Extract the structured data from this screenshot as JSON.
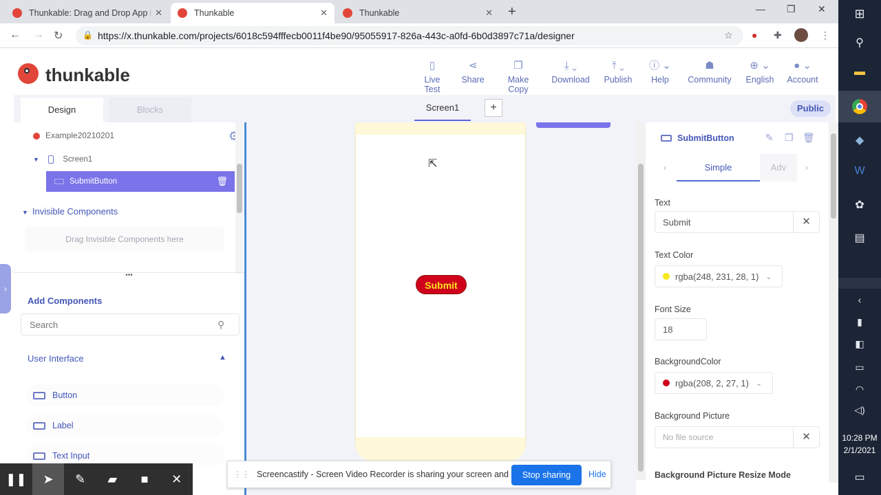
{
  "browser": {
    "tabs": [
      {
        "title": "Thunkable: Drag and Drop App B",
        "active": false
      },
      {
        "title": "Thunkable",
        "active": true
      },
      {
        "title": "Thunkable",
        "active": false
      }
    ],
    "url": "https://x.thunkable.com/projects/6018c594fffecb0011f4be90/95055917-826a-443c-a0fd-6b0d3897c71a/designer"
  },
  "app": {
    "logo_text": "thunkable",
    "nav": [
      {
        "label": "Live Test",
        "icon": "phone-icon"
      },
      {
        "label": "Share",
        "icon": "share-icon"
      },
      {
        "label": "Make Copy",
        "icon": "copy-icon"
      },
      {
        "label": "Download",
        "icon": "download-icon"
      },
      {
        "label": "Publish",
        "icon": "publish-icon"
      },
      {
        "label": "Help",
        "icon": "help-icon"
      },
      {
        "label": "Community",
        "icon": "community-icon"
      },
      {
        "label": "English",
        "icon": "globe-icon"
      },
      {
        "label": "Account",
        "icon": "account-icon"
      }
    ]
  },
  "modebar": {
    "design": "Design",
    "blocks": "Blocks",
    "screen": "Screen1",
    "add": "+",
    "public": "Public"
  },
  "tree": {
    "project": "Example20210201",
    "screen": "Screen1",
    "selected": "SubmitButton",
    "invisible_header": "Invisible Components",
    "invisible_drop": "Drag Invisible Components here"
  },
  "add_components": {
    "title": "Add Components",
    "search_placeholder": "Search",
    "section": "User Interface",
    "items": [
      "Button",
      "Label",
      "Text Input"
    ]
  },
  "canvas": {
    "button_text": "Submit"
  },
  "properties": {
    "title": "SubmitButton",
    "tab_simple": "Simple",
    "tab_advanced": "Adv",
    "text_label": "Text",
    "text_value": "Submit",
    "text_color_label": "Text Color",
    "text_color_value": "rgba(248, 231, 28, 1)",
    "font_size_label": "Font Size",
    "font_size_value": "18",
    "bg_color_label": "BackgroundColor",
    "bg_color_value": "rgba(208, 2, 27, 1)",
    "bg_picture_label": "Background Picture",
    "bg_picture_value": "No file source",
    "bg_resize_label": "Background Picture Resize Mode",
    "colors": {
      "text": "#f8e71c",
      "background": "#d0021b"
    }
  },
  "screencastify": {
    "message": "Screencastify - Screen Video Recorder is sharing your screen and audio.",
    "stop": "Stop sharing",
    "hide": "Hide"
  },
  "taskbar": {
    "time": "10:28 PM",
    "date": "2/1/2021"
  }
}
